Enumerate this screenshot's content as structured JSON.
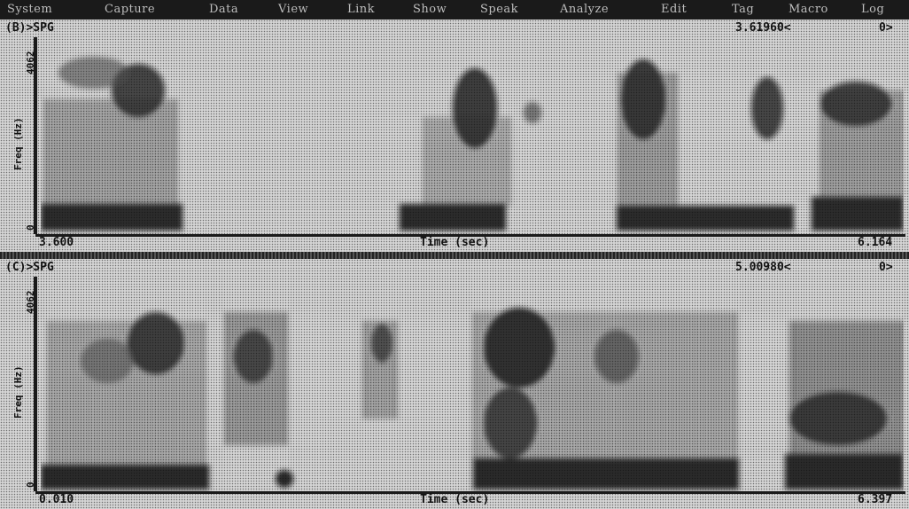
{
  "menu": {
    "items": [
      "System",
      "Capture",
      "Data",
      "View",
      "Link",
      "Show",
      "Speak",
      "Analyze",
      "Edit",
      "Tag",
      "Macro",
      "Log"
    ]
  },
  "panels": [
    {
      "label": "(B)>SPG",
      "cursor_value": "3.61960<",
      "cursor_mark": "0>",
      "y_top": "4062",
      "y_label": "Freq (Hz)",
      "y_bottom": "0",
      "x_start": "3.600",
      "x_label": "Time (sec)",
      "x_end": "6.164"
    },
    {
      "label": "(C)>SPG",
      "cursor_value": "5.00980<",
      "cursor_mark": "0>",
      "y_top": "4062",
      "y_label": "Freq (Hz)",
      "y_bottom": "0",
      "x_start": "0.010",
      "x_label": "Time (sec)",
      "x_end": "6.397"
    }
  ],
  "colors": {
    "menubar": "#1a1a1a",
    "menu_text": "#bdbdbd",
    "ink": "#111111"
  },
  "icons": {
    "spectrogram": "spectrogram-image"
  }
}
